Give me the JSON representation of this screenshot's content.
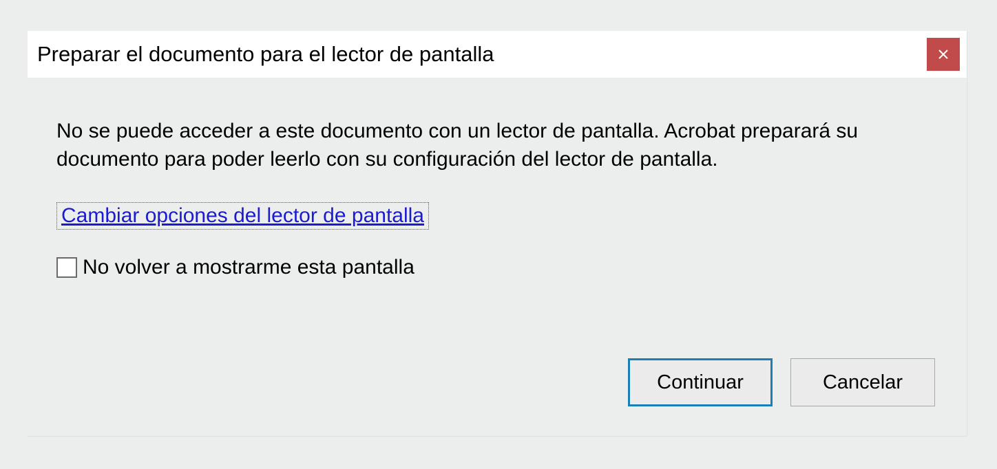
{
  "dialog": {
    "title": "Preparar el documento para el lector de pantalla",
    "close_icon": "×",
    "message": "No se puede acceder a este documento con un lector de pantalla. Acrobat preparará su documento para poder leerlo con su configuración del lector de pantalla.",
    "link_label": "Cambiar opciones del lector de pantalla",
    "checkbox_label": "No volver a mostrarme esta pantalla",
    "checkbox_checked": false,
    "buttons": {
      "continue": "Continuar",
      "cancel": "Cancelar"
    }
  }
}
